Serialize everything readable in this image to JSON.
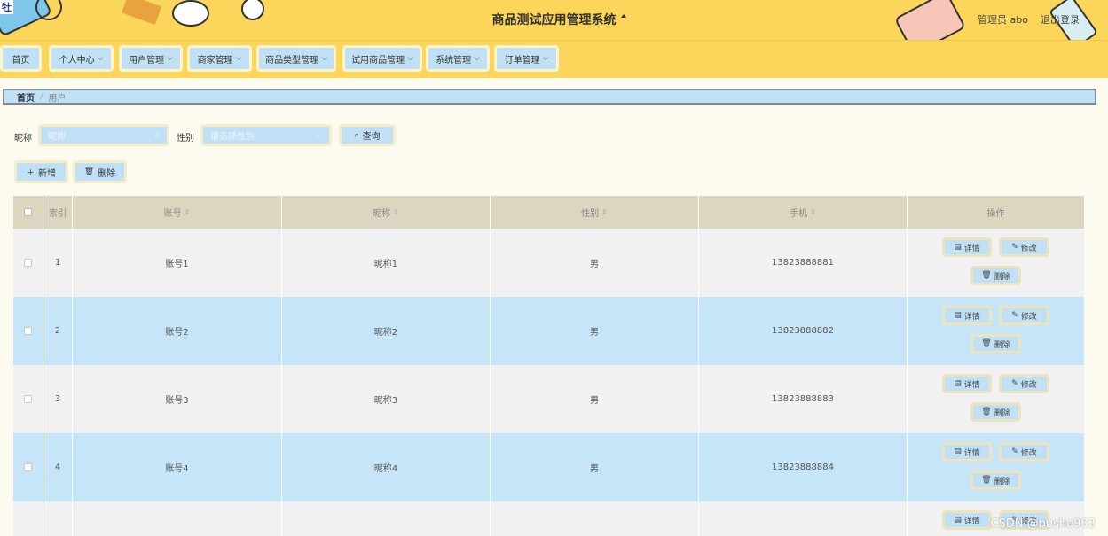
{
  "header": {
    "logo_text": "牡",
    "title": "商品测试应用管理系统",
    "admin": "管理员 abo",
    "logout": "退出登录"
  },
  "nav": [
    {
      "label": "首页",
      "has_dropdown": false
    },
    {
      "label": "个人中心",
      "has_dropdown": true
    },
    {
      "label": "用户管理",
      "has_dropdown": true
    },
    {
      "label": "商家管理",
      "has_dropdown": true
    },
    {
      "label": "商品类型管理",
      "has_dropdown": true
    },
    {
      "label": "试用商品管理",
      "has_dropdown": true
    },
    {
      "label": "系统管理",
      "has_dropdown": true
    },
    {
      "label": "订单管理",
      "has_dropdown": true
    }
  ],
  "breadcrumb": {
    "home": "首页",
    "separator": "/",
    "current": "用户"
  },
  "search": {
    "nickname_label": "昵称",
    "nickname_placeholder": "昵称",
    "gender_label": "性别",
    "gender_placeholder": "请选择性别",
    "query_button": "查询"
  },
  "actions": {
    "add": "新增",
    "delete": "删除"
  },
  "table": {
    "headers": {
      "index": "索引",
      "account": "账号",
      "nickname": "昵称",
      "gender": "性别",
      "phone": "手机",
      "ops": "操作"
    },
    "rows": [
      {
        "index": "1",
        "account": "账号1",
        "nickname": "昵称1",
        "gender": "男",
        "phone": "13823888881"
      },
      {
        "index": "2",
        "account": "账号2",
        "nickname": "昵称2",
        "gender": "男",
        "phone": "13823888882"
      },
      {
        "index": "3",
        "account": "账号3",
        "nickname": "昵称3",
        "gender": "男",
        "phone": "13823888883"
      },
      {
        "index": "4",
        "account": "账号4",
        "nickname": "昵称4",
        "gender": "男",
        "phone": "13823888884"
      },
      {
        "index": "",
        "account": "",
        "nickname": "",
        "gender": "",
        "phone": ""
      }
    ],
    "row_buttons": {
      "detail": "详情",
      "edit": "修改",
      "delete": "删除"
    }
  },
  "watermark": "CSDN @bushe902",
  "colors": {
    "header_bg": "#fcd65a",
    "button_bg": "#bfe0f5",
    "row_alt_bg": "#c6e5f8",
    "thead_bg": "#dcd5c0"
  }
}
